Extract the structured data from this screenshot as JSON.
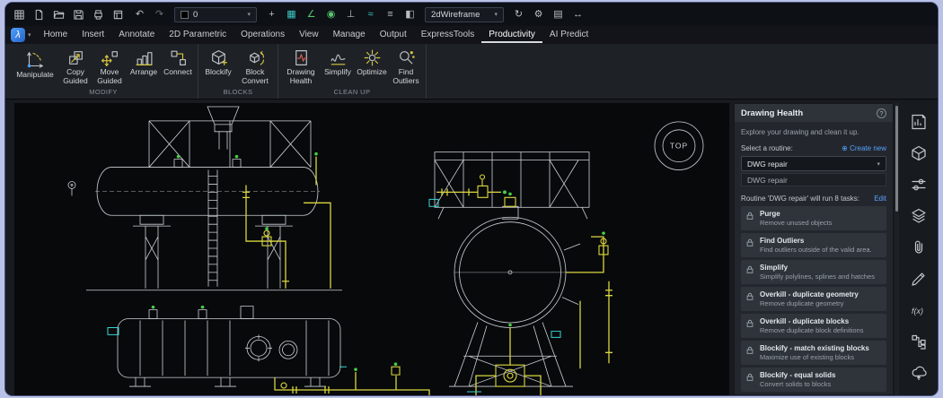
{
  "titlebar": {
    "layer_value": "0",
    "view_style": "2dWireframe",
    "undo_glyph": "↶",
    "redo_glyph": "↷",
    "icons_left": [
      "app-grid-icon",
      "new-file-icon",
      "open-file-icon",
      "save-icon",
      "print-icon",
      "plot-icon"
    ],
    "icons_middle": [
      "crosshair-icon",
      "grid-icon",
      "angle-icon",
      "osnap-icon",
      "ortho-icon",
      "spline-icon",
      "lineweight-icon",
      "transparency-icon"
    ],
    "icons_right": [
      "redraw-icon",
      "settings-icon",
      "layout-icon",
      "fullscreen-icon"
    ]
  },
  "tabs": {
    "logo_glyph": "λ",
    "items": [
      {
        "label": "Home"
      },
      {
        "label": "Insert"
      },
      {
        "label": "Annotate"
      },
      {
        "label": "2D Parametric"
      },
      {
        "label": "Operations"
      },
      {
        "label": "View"
      },
      {
        "label": "Manage"
      },
      {
        "label": "Output"
      },
      {
        "label": "ExpressTools"
      },
      {
        "label": "Productivity",
        "active": true
      },
      {
        "label": "AI Predict"
      }
    ]
  },
  "ribbon": {
    "groups": [
      {
        "label": "MODIFY",
        "tools": [
          {
            "label": "Manipulate"
          },
          {
            "label": "Copy Guided"
          },
          {
            "label": "Move Guided"
          },
          {
            "label": "Arrange"
          },
          {
            "label": "Connect"
          }
        ]
      },
      {
        "label": "BLOCKS",
        "tools": [
          {
            "label": "Blockify"
          },
          {
            "label": "Block Convert"
          }
        ]
      },
      {
        "label": "CLEAN UP",
        "tools": [
          {
            "label": "Drawing Health"
          },
          {
            "label": "Simplify"
          },
          {
            "label": "Optimize"
          },
          {
            "label": "Find Outliers"
          }
        ]
      }
    ]
  },
  "viewport": {
    "viewcube_label": "TOP"
  },
  "panel": {
    "title": "Drawing Health",
    "help": "?",
    "subtitle": "Explore your drawing and clean it up.",
    "routine_label": "Select a routine:",
    "create_new": "⊕ Create new",
    "selected_routine": "DWG repair",
    "dropdown_option": "DWG repair",
    "tasks_header": "Routine 'DWG repair' will run 8 tasks:",
    "edit_label": "Edit",
    "tasks": [
      {
        "name": "Purge",
        "desc": "Remove unused objects"
      },
      {
        "name": "Find Outliers",
        "desc": "Find outliers outside of the valid area."
      },
      {
        "name": "Simplify",
        "desc": "Simplify polylines, splines and hatches"
      },
      {
        "name": "Overkill - duplicate geometry",
        "desc": "Remove duplicate geometry"
      },
      {
        "name": "Overkill - duplicate blocks",
        "desc": "Remove duplicate block definitions"
      },
      {
        "name": "Blockify - match existing blocks",
        "desc": "Maximize use of existing blocks"
      },
      {
        "name": "Blockify - equal solids",
        "desc": "Convert solids to blocks"
      }
    ]
  },
  "dock": {
    "fx_glyph": "f(x)",
    "icons": [
      "report-panel-icon",
      "model-panel-icon",
      "properties-panel-icon",
      "layers-panel-icon",
      "attachments-panel-icon",
      "annotate-panel-icon",
      "parameters-panel-icon",
      "structure-panel-icon",
      "cloud-sync-panel-icon"
    ]
  },
  "colors": {
    "accent": "#57a2ff",
    "line_white": "#ccd1d6",
    "line_yellow": "#d9d73e",
    "line_cyan": "#39d6d6",
    "line_green": "#45d145"
  }
}
